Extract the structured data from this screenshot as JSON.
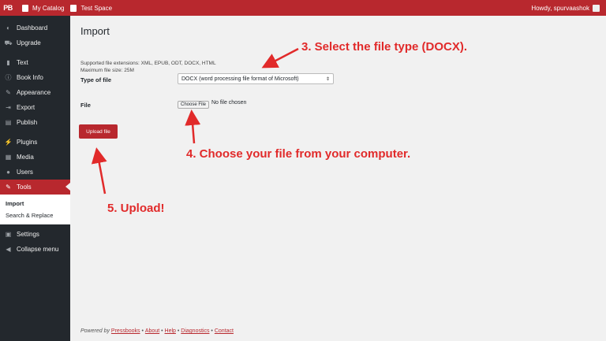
{
  "adminbar": {
    "logo": "PB",
    "items": [
      "My Catalog",
      "Test Space"
    ],
    "greeting": "Howdy, spurvaashok"
  },
  "sidebar": {
    "items": [
      {
        "label": "Dashboard",
        "icon": "dashboard-icon",
        "glyph": "◐"
      },
      {
        "label": "Upgrade",
        "icon": "cart-icon",
        "glyph": "⛟"
      },
      {
        "label": "Text",
        "icon": "book-icon",
        "glyph": "▮"
      },
      {
        "label": "Book Info",
        "icon": "info-icon",
        "glyph": "ⓘ"
      },
      {
        "label": "Appearance",
        "icon": "brush-icon",
        "glyph": "✎"
      },
      {
        "label": "Export",
        "icon": "export-icon",
        "glyph": "⇥"
      },
      {
        "label": "Publish",
        "icon": "publish-icon",
        "glyph": "▤"
      },
      {
        "label": "Plugins",
        "icon": "plug-icon",
        "glyph": "⚡"
      },
      {
        "label": "Media",
        "icon": "media-icon",
        "glyph": "▦"
      },
      {
        "label": "Users",
        "icon": "user-icon",
        "glyph": "●"
      },
      {
        "label": "Tools",
        "icon": "wrench-icon",
        "glyph": "✎"
      },
      {
        "label": "Settings",
        "icon": "settings-icon",
        "glyph": "▣"
      },
      {
        "label": "Collapse menu",
        "icon": "collapse-icon",
        "glyph": "◀"
      }
    ],
    "submenu": [
      "Import",
      "Search & Replace"
    ]
  },
  "main": {
    "title": "Import",
    "info_line1": "Supported file extensions: XML, EPUB, ODT, DOCX, HTML",
    "info_line2": "Maximum file size: 25M",
    "type_label": "Type of file",
    "type_value": "DOCX (word processing file format of Microsoft)",
    "file_label": "File",
    "choose_file": "Choose File",
    "file_status": "No file chosen",
    "upload_label": "Upload file"
  },
  "footer": {
    "powered": "Powered by",
    "links": [
      "Pressbooks",
      "About",
      "Help",
      "Diagnostics",
      "Contact"
    ],
    "separator": "•"
  },
  "annotations": {
    "step3": "3. Select the file type (DOCX).",
    "step4": "4. Choose your file from your computer.",
    "step5": "5. Upload!"
  },
  "colors": {
    "brand": "#b8282e",
    "annotation": "#e12a2a",
    "sidebar": "#23282d"
  }
}
